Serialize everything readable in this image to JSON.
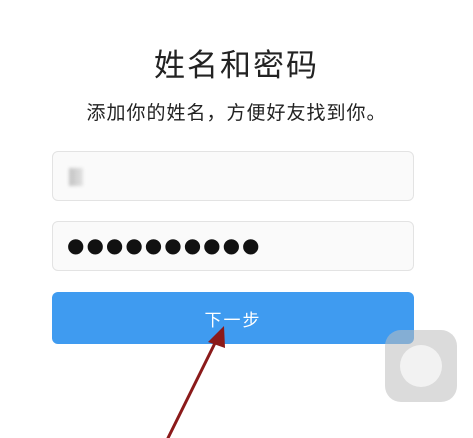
{
  "title": "姓名和密码",
  "subtitle": "添加你的姓名，方便好友找到你。",
  "name_field": {
    "value_hidden": true
  },
  "password_field": {
    "value": "●●●●●●●●●●"
  },
  "next_button": {
    "label": "下一步",
    "color": "#3f9bf0"
  },
  "annotation": {
    "arrow_color": "#8b1a1a"
  }
}
